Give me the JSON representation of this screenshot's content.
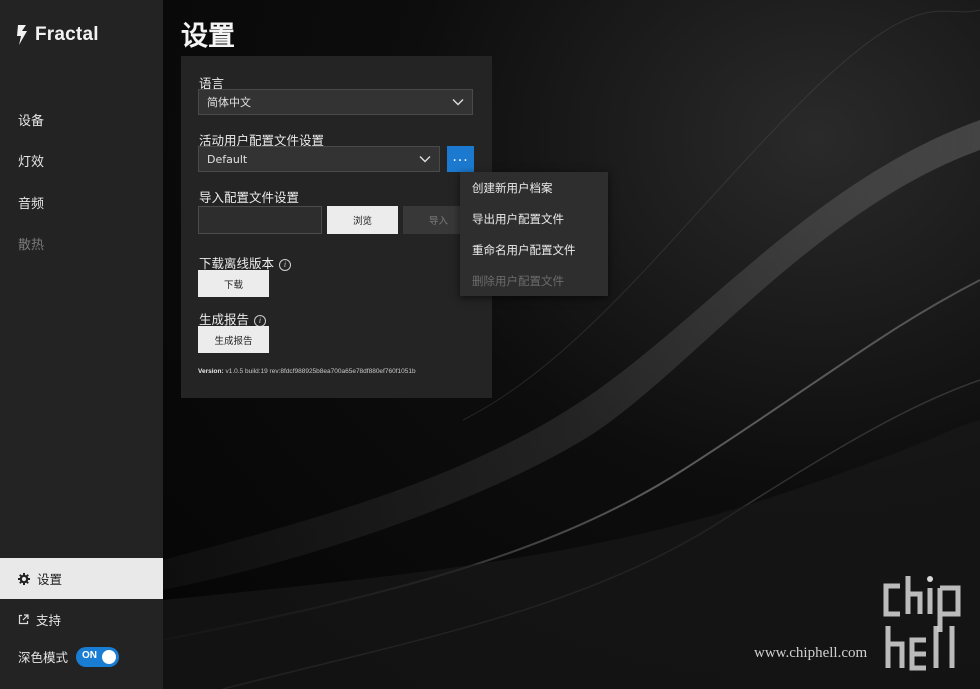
{
  "app": {
    "brand": "Fractal"
  },
  "sidebar": {
    "items": [
      {
        "label": "设备",
        "enabled": true
      },
      {
        "label": "灯效",
        "enabled": true
      },
      {
        "label": "音频",
        "enabled": true
      },
      {
        "label": "散热",
        "enabled": false
      }
    ],
    "settings_label": "设置",
    "support_label": "支持",
    "dark_mode_label": "深色模式",
    "dark_mode_toggle": "ON"
  },
  "page": {
    "title": "设置"
  },
  "settings": {
    "language": {
      "label": "语言",
      "value": "简体中文"
    },
    "active_profile": {
      "label": "活动用户配置文件设置",
      "value": "Default"
    },
    "import_profile": {
      "label": "导入配置文件设置",
      "browse_label": "浏览",
      "import_label": "导入",
      "file_value": ""
    },
    "offline": {
      "label": "下载离线版本",
      "button_label": "下载"
    },
    "report": {
      "label": "生成报告",
      "button_label": "生成报告"
    },
    "version": {
      "prefix": "Version:",
      "text": "v1.0.5 build:19 rev:8fdcf988925b8ea700a65e78df880ef760f1051b"
    }
  },
  "profile_menu": {
    "items": [
      {
        "label": "创建新用户档案",
        "enabled": true
      },
      {
        "label": "导出用户配置文件",
        "enabled": true
      },
      {
        "label": "重命名用户配置文件",
        "enabled": true
      },
      {
        "label": "删除用户配置文件",
        "enabled": false
      }
    ]
  },
  "watermark": {
    "url": "www.chiphell.com",
    "logo_text": "chip hell"
  },
  "colors": {
    "accent": "#1b7ad0",
    "sidebar_bg": "#232323",
    "panel_bg": "#242424"
  },
  "icons": {
    "more": "more-horizontal-icon",
    "settings": "gear-icon",
    "support": "external-link-icon"
  }
}
